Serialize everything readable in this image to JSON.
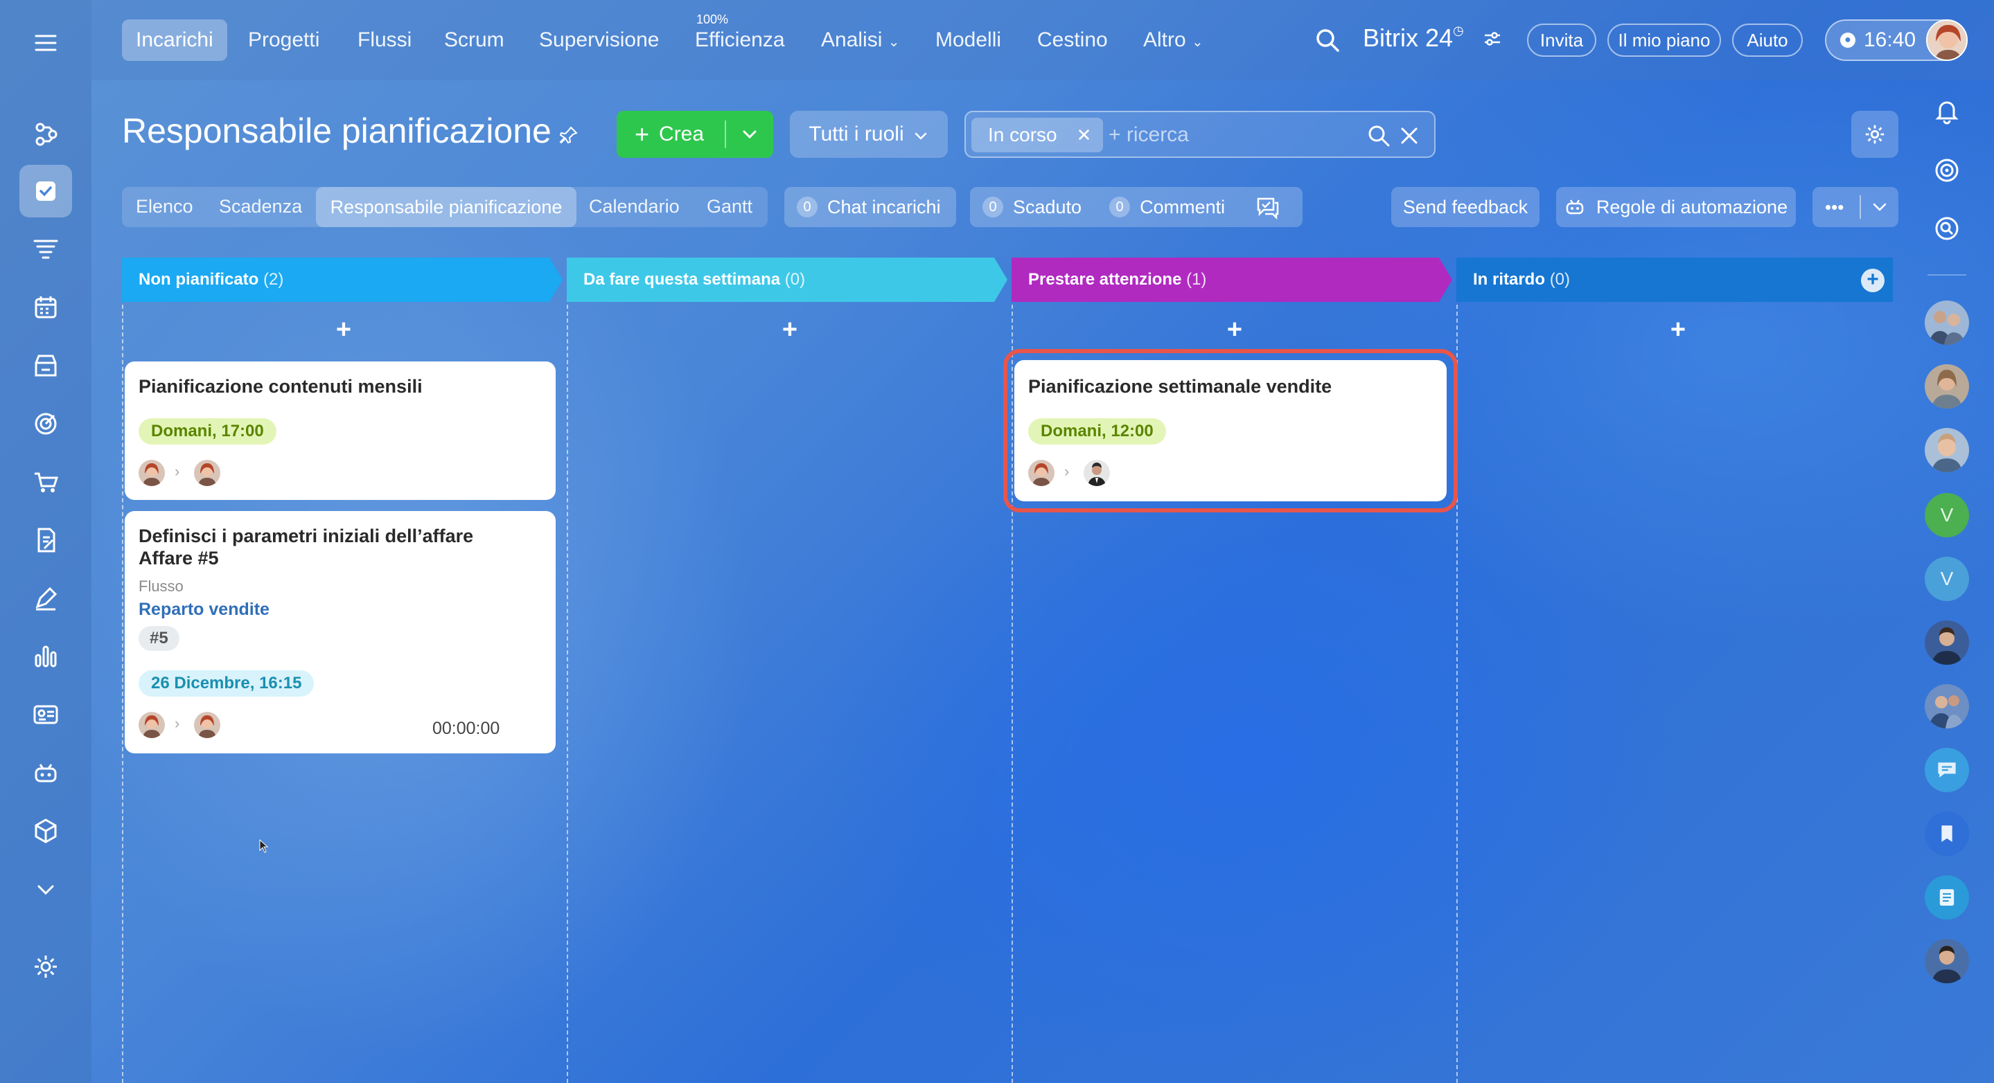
{
  "topnav": {
    "items": [
      "Incarichi",
      "Progetti",
      "Flussi",
      "Scrum",
      "Supervisione",
      "Efficienza",
      "Analisi",
      "Modelli",
      "Cestino",
      "Altro"
    ],
    "efficiency_badge": "100%"
  },
  "header_right": {
    "brand": "Bitrix 24",
    "invite": "Invita",
    "plan": "Il mio piano",
    "help": "Aiuto",
    "time": "16:40"
  },
  "page": {
    "title": "Responsabile pianificazione",
    "create": "Crea",
    "roles": "Tutti i ruoli",
    "filter_chip": "In corso",
    "search_placeholder": "+ ricerca"
  },
  "views": {
    "tabs": [
      "Elenco",
      "Scadenza",
      "Responsabile pianificazione",
      "Calendario",
      "Gantt"
    ],
    "active": "Responsabile pianificazione"
  },
  "counters": {
    "chat_count": "0",
    "chat_label": "Chat incarichi",
    "overdue_count": "0",
    "overdue_label": "Scaduto",
    "comments_count": "0",
    "comments_label": "Commenti"
  },
  "actions": {
    "feedback": "Send feedback",
    "automation": "Regole di automazione",
    "more": "•••"
  },
  "columns": [
    {
      "title": "Non pianificato",
      "count": "(2)",
      "color": "#1aa9f2"
    },
    {
      "title": "Da fare questa settimana",
      "count": "(0)",
      "color": "#3ec8e8"
    },
    {
      "title": "Prestare attenzione",
      "count": "(1)",
      "color": "#b02ac0"
    },
    {
      "title": "In ritardo",
      "count": "(0)",
      "color": "#1676d2"
    }
  ],
  "cards": [
    {
      "title": "Pianificazione contenuti mensili",
      "deadline": "Domani, 17:00"
    },
    {
      "title_line1": "Definisci i parametri iniziali dell’affare",
      "title_line2": "Affare #5",
      "flow_label": "Flusso",
      "flow_name": "Reparto vendite",
      "tag": "#5",
      "deadline": "26 Dicembre, 16:15",
      "timer": "00:00:00"
    },
    {
      "title": "Pianificazione settimanale vendite",
      "deadline": "Domani, 12:00",
      "highlighted": true
    }
  ],
  "right_avatars": {
    "v1": "V",
    "v2": "V"
  },
  "colors": {
    "accent_green": "#2ec74e",
    "deadline_green_bg": "#e3f5b6",
    "deadline_green_text": "#5a8500",
    "deadline_blue_bg": "#d8f3fb",
    "deadline_blue_text": "#1a8fb0",
    "highlight": "#e8554a"
  }
}
